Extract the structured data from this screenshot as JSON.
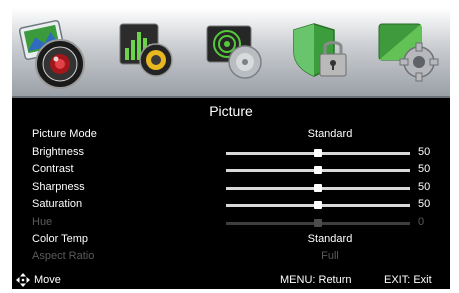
{
  "menu": {
    "tabs": [
      {
        "icon": "picture-camera-icon",
        "selected": true
      },
      {
        "icon": "audio-speaker-icon",
        "selected": false
      },
      {
        "icon": "channel-disc-icon",
        "selected": false
      },
      {
        "icon": "lock-shield-icon",
        "selected": false
      },
      {
        "icon": "setup-gear-icon",
        "selected": false
      }
    ]
  },
  "title": "Picture",
  "rows": {
    "picture_mode": {
      "label": "Picture Mode",
      "value": "Standard"
    },
    "brightness": {
      "label": "Brightness",
      "value": "50",
      "level": 50
    },
    "contrast": {
      "label": "Contrast",
      "value": "50",
      "level": 50
    },
    "sharpness": {
      "label": "Sharpness",
      "value": "50",
      "level": 50
    },
    "saturation": {
      "label": "Saturation",
      "value": "50",
      "level": 50
    },
    "hue": {
      "label": "Hue",
      "value": "0",
      "level": 50,
      "disabled": true
    },
    "color_temp": {
      "label": "Color Temp",
      "value": "Standard"
    },
    "aspect_ratio": {
      "label": "Aspect Ratio",
      "value": "Full",
      "disabled": true
    }
  },
  "footer": {
    "move_icon": "directional-pad-icon",
    "move_label": "Move",
    "return_label": "MENU: Return",
    "exit_label": "EXIT: Exit"
  },
  "colors": {
    "background": "#000000",
    "text": "#ffffff",
    "disabled_text": "#5b5b5b",
    "icon_bar_top": "#ffffff",
    "icon_bar_bottom": "#9aa0a7"
  }
}
